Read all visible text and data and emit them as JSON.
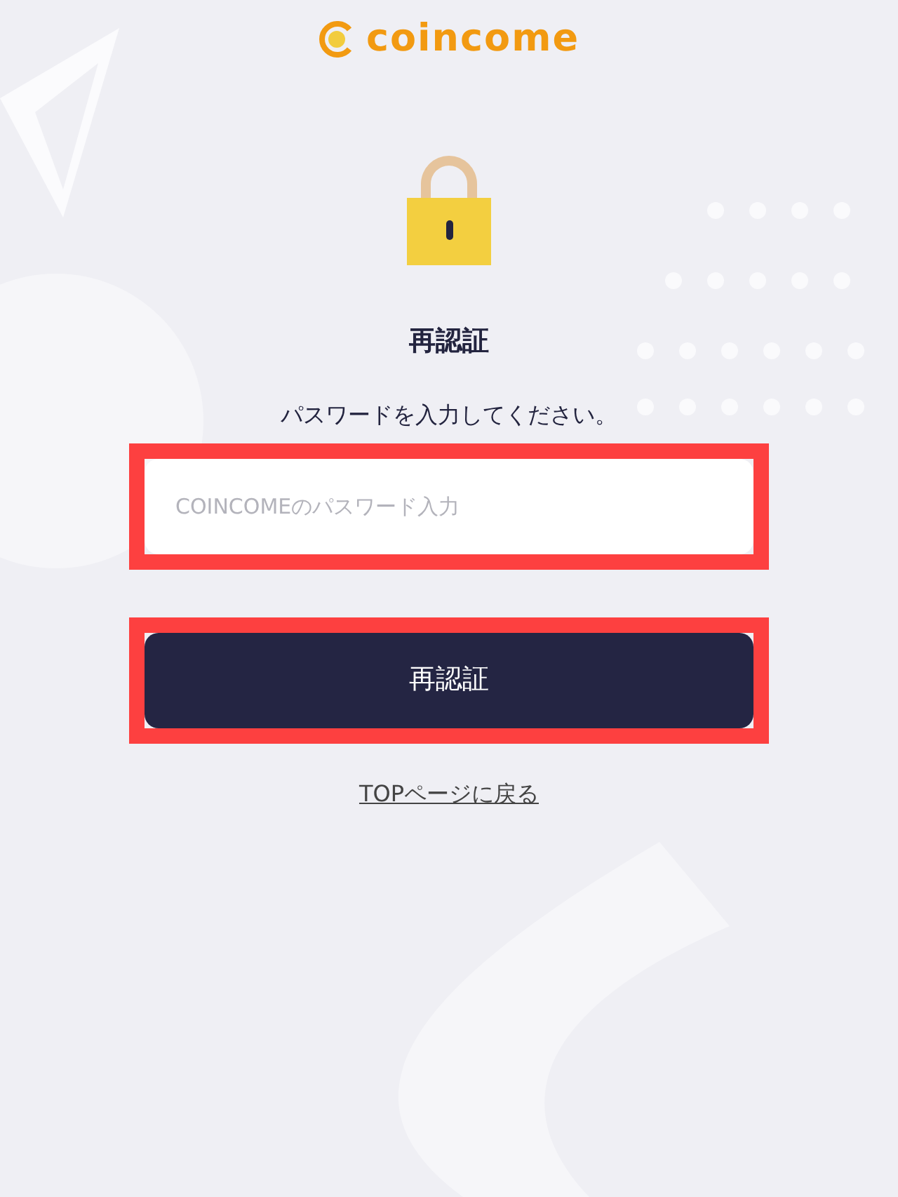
{
  "logo": {
    "text": "coincome"
  },
  "title": "再認証",
  "instruction": "パスワードを入力してください。",
  "password_field": {
    "placeholder": "COINCOMEのパスワード入力",
    "highlighted": true
  },
  "submit_button": {
    "label": "再認証",
    "highlighted": true
  },
  "back_link": "TOPページに戻る"
}
